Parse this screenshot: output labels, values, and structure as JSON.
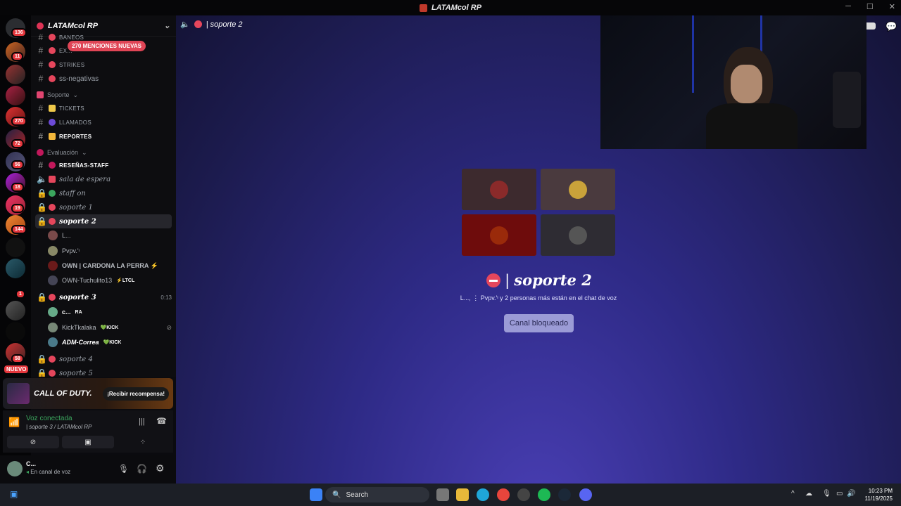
{
  "window": {
    "title": "LATAMcol RP"
  },
  "guilds": {
    "badges": [
      "136",
      "11",
      "270",
      "72",
      "56",
      "18",
      "19",
      "144",
      "1",
      "58"
    ],
    "new_label": "NUEVO"
  },
  "server": {
    "name": "LATAMcol RP",
    "mention_pill": "270 MENCIONES NUEVAS",
    "channels": {
      "bans": "BANEOS",
      "extra": "EX...",
      "strikes": "STRIKES",
      "ss_negativas": "ss-negativas",
      "cat_soporte": "Soporte",
      "tickets": "TICKETS",
      "llamados": "LLAMADOS",
      "reportes": "REPORTES",
      "cat_evaluacion": "Evaluación",
      "resenas": "RESEÑAS-STAFF",
      "sala_espera": "sala de espera",
      "staff_on": "staff on",
      "soporte1": "soporte 1",
      "soporte2": "soporte 2",
      "soporte3": "soporte 3",
      "soporte3_time": "0:13",
      "soporte4": "soporte 4",
      "soporte5": "soporte 5"
    },
    "soporte2_members": [
      {
        "name": "L...",
        "tag": ""
      },
      {
        "name": "Pvpv.'ᶦ",
        "tag": ""
      },
      {
        "name": "OWN | CARDONA LA PERRA ⚡",
        "tag": ""
      },
      {
        "name": "OWN-Tuchulito13",
        "tag": "⚡LTCL"
      }
    ],
    "soporte3_members": [
      {
        "name": "c...",
        "tag": "RA"
      },
      {
        "name": "KickTkalaka",
        "tag": "💚KICK"
      },
      {
        "name": "ADM-Correa",
        "tag": "💚KICK"
      }
    ]
  },
  "promo": {
    "brand": "CALL OF DUTY.",
    "action": "¡Recibir recompensa!"
  },
  "voice": {
    "status": "Voz conectada",
    "channel": "| soporte 3 / LATAMcol RP"
  },
  "user": {
    "name": "C...",
    "status": "En canal de voz"
  },
  "main": {
    "channel_title": "| soporte 2",
    "voice_title": "soporte 2",
    "voice_subtitle": "L..., ⋮ Pvpv.'ᶦ y 2 personas más están en el chat de voz",
    "locked_button": "Canal bloqueado"
  },
  "taskbar": {
    "search_placeholder": "Search",
    "time": "10:23 PM",
    "date": "11/19/2025"
  }
}
